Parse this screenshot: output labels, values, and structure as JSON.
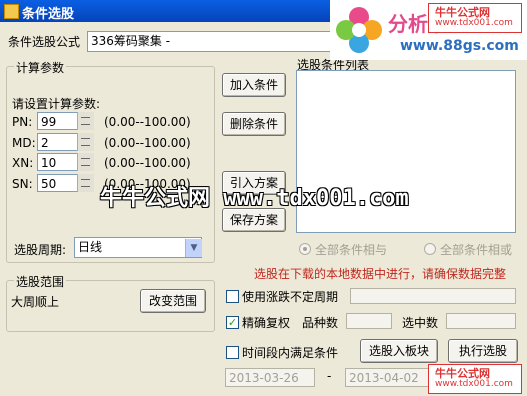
{
  "window": {
    "title": "条件选股"
  },
  "formula": {
    "label": "条件选股公式",
    "value": "336筹码聚集 -"
  },
  "params": {
    "group_title": "计算参数",
    "prompt": "请设置计算参数:",
    "rows": [
      {
        "name": "PN:",
        "value": "99",
        "range": "(0.00--100.00)"
      },
      {
        "name": "MD:",
        "value": "2",
        "range": "(0.00--100.00)"
      },
      {
        "name": "XN:",
        "value": "10",
        "range": "(0.00--100.00)"
      },
      {
        "name": "SN:",
        "value": "50",
        "range": "(0.00--100.00)"
      }
    ],
    "period_label": "选股周期:",
    "period_value": "日线"
  },
  "buttons": {
    "add_condition": "加入条件",
    "delete_condition": "删除条件",
    "import_plan": "引入方案",
    "save_plan": "保存方案",
    "change_range": "改变范围",
    "select_to_block": "选股入板块",
    "execute": "执行选股"
  },
  "condition_list": {
    "title": "选股条件列表"
  },
  "logic": {
    "and_label": "全部条件相与",
    "or_label": "全部条件相或"
  },
  "notice": "选股在下载的本地数据中进行，请确保数据完整",
  "range": {
    "group_title": "选股范围",
    "value": "大周顺上"
  },
  "options": {
    "use_price_limit": "使用涨跌不定周期",
    "exact_adjust": "精确复权",
    "exact_adjust_checked": true,
    "varieties_label": "品种数",
    "selected_label": "选中数",
    "time_segment": "时间段内满足条件"
  },
  "dates": {
    "start": "2013-03-26",
    "separator": "-",
    "end": "2013-04-02"
  },
  "watermark": {
    "text": "牛牛公式网 www.tdx001.com",
    "logo_text": "分析家",
    "logo_url": "www.88gs.com",
    "badge_top": "牛牛公式网",
    "badge_top_url": "www.tdx001.com",
    "badge_bottom": "牛牛公式网",
    "badge_bottom_url": "www.tdx001.com"
  }
}
